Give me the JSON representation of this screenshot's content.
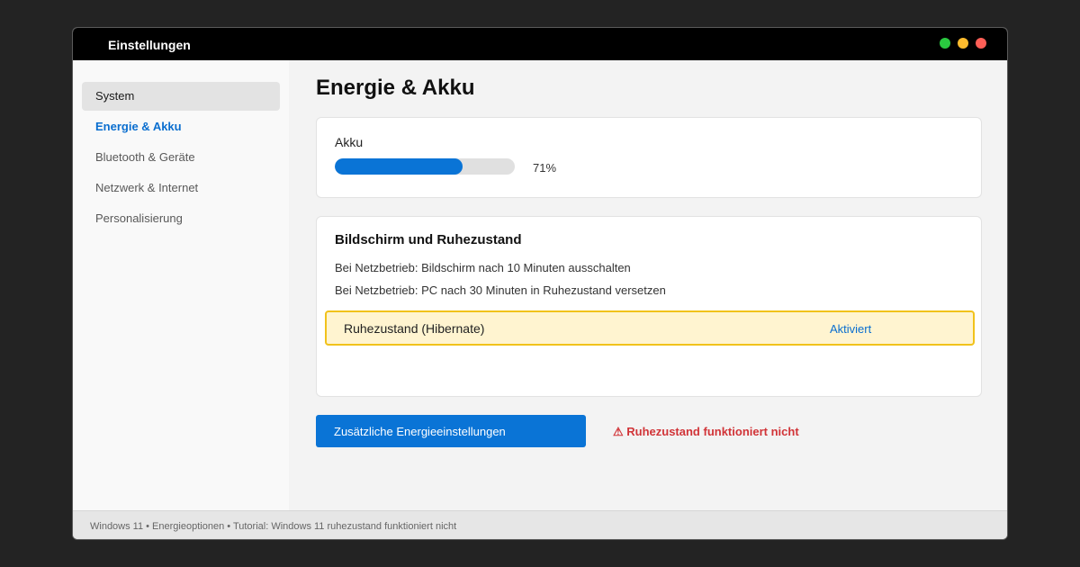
{
  "window": {
    "title": "Einstellungen",
    "controls": [
      {
        "name": "maximize",
        "color": "#2ac840"
      },
      {
        "name": "minimize",
        "color": "#febc2e"
      },
      {
        "name": "close",
        "color": "#ff5f57"
      }
    ]
  },
  "sidebar": {
    "items": [
      {
        "label": "System",
        "state": "selected"
      },
      {
        "label": "Energie & Akku",
        "state": "active"
      },
      {
        "label": "Bluetooth & Geräte",
        "state": "normal"
      },
      {
        "label": "Netzwerk & Internet",
        "state": "normal"
      },
      {
        "label": "Personalisierung",
        "state": "normal"
      }
    ]
  },
  "main": {
    "page_title": "Energie & Akku",
    "battery": {
      "label": "Akku",
      "level_percent": 71,
      "level_text": "71%"
    },
    "sleep": {
      "title": "Bildschirm und Ruhezustand",
      "lines": [
        "Bei Netzbetrieb: Bildschirm nach 10 Minuten ausschalten",
        "Bei Netzbetrieb: PC nach 30 Minuten in Ruhezustand versetzen"
      ],
      "hibernate": {
        "label": "Ruhezustand (Hibernate)",
        "value": "Aktiviert"
      }
    },
    "more_button_label": "Zusätzliche Energieeinstellungen",
    "warning": {
      "icon": "warning-icon",
      "text": "⚠ Ruhezustand funktioniert nicht"
    }
  },
  "footer": {
    "text": "Windows 11 • Energieoptionen • Tutorial: Windows 11 ruhezustand funktioniert nicht"
  },
  "colors": {
    "accent": "#0a74d6",
    "warning": "#d13438",
    "highlight_bg": "#fff4d0",
    "highlight_border": "#f1c21b"
  }
}
